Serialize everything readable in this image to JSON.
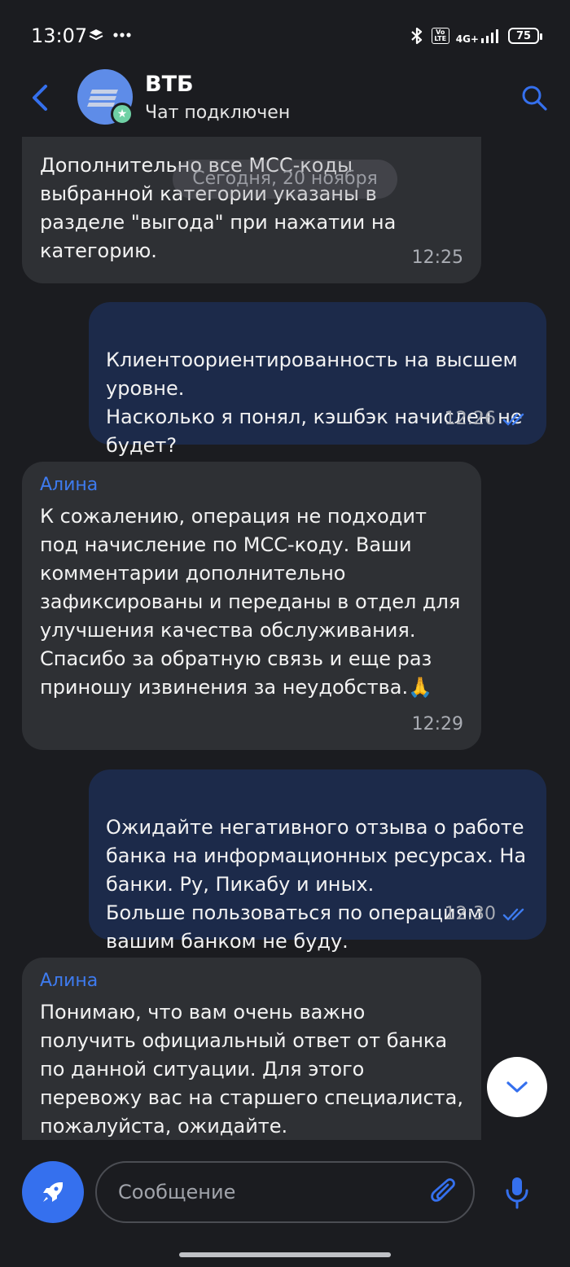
{
  "status_bar": {
    "time": "13:07",
    "network": "4G+",
    "volte": "VoLTE",
    "battery": "75"
  },
  "header": {
    "title": "ВТБ",
    "subtitle": "Чат подключен"
  },
  "chat": {
    "date_separator": "Сегодня, 20 ноября",
    "messages": [
      {
        "direction": "incoming",
        "text": "Дополнительно все МСС-коды выбранной категории указаны в разделе \"выгода\" при нажатии на категорию.",
        "time": "12:25"
      },
      {
        "direction": "outgoing",
        "text": "Клиентоориентированность на высшем уровне.\nНасколько я понял, кэшбэк начислен не будет?",
        "time": "12:26",
        "read": true
      },
      {
        "direction": "incoming",
        "sender": "Алина",
        "text": "К сожалению, операция не подходит под начисление по МСС-коду. Ваши комментарии дополнительно зафиксированы и переданы в отдел для улучшения качества обслуживания. Спасибо за обратную связь и еще раз приношу извинения за неудобства.🙏",
        "time": "12:29"
      },
      {
        "direction": "outgoing",
        "text": "Ожидайте негативного отзыва о работе банка на информационных ресурсах. На банки. Ру, Пикабу и иных.\nБольше пользоваться по операциям вашим банком не буду.",
        "time": "12:30",
        "read": true
      },
      {
        "direction": "incoming",
        "sender": "Алина",
        "text": "Понимаю, что вам очень важно получить официальный ответ от банка по данной ситуации. Для этого перевожу вас на старшего специалиста, пожалуйста, ожидайте."
      }
    ]
  },
  "composer": {
    "placeholder": "Сообщение"
  },
  "colors": {
    "background": "#1b1c20",
    "incoming_bubble": "#2e3034",
    "outgoing_bubble": "#1c2a4a",
    "accent": "#3570ee",
    "sender_name": "#3e7bef"
  },
  "icons": [
    "layers-icon",
    "more-dots-icon",
    "bluetooth-icon",
    "signal-icon",
    "battery-icon",
    "back-arrow-icon",
    "search-icon",
    "read-checkmarks-icon",
    "chevron-down-icon",
    "rocket-icon",
    "paperclip-icon",
    "microphone-icon"
  ]
}
